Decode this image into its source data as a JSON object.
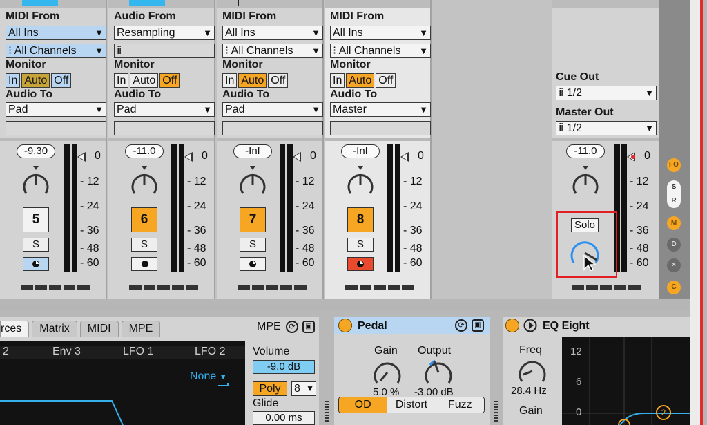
{
  "tracks": [
    {
      "midi_from_label": "MIDI From",
      "from": "All Ins",
      "channel": "All Channels",
      "monitor_label": "Monitor",
      "monitor": [
        "In",
        "Auto",
        "Off"
      ],
      "monitor_active": "Auto",
      "audio_to_label": "Audio To",
      "to": "Pad",
      "volume": "-9.30",
      "number": "5",
      "solo": "S"
    },
    {
      "midi_from_label": "Audio From",
      "from": "Resampling",
      "channel": "",
      "monitor_label": "Monitor",
      "monitor": [
        "In",
        "Auto",
        "Off"
      ],
      "monitor_active": "Off",
      "audio_to_label": "Audio To",
      "to": "Pad",
      "volume": "-11.0",
      "number": "6",
      "solo": "S"
    },
    {
      "midi_from_label": "MIDI From",
      "from": "All Ins",
      "channel": "All Channels",
      "monitor_label": "Monitor",
      "monitor": [
        "In",
        "Auto",
        "Off"
      ],
      "monitor_active": "Auto",
      "audio_to_label": "Audio To",
      "to": "Pad",
      "volume": "-Inf",
      "number": "7",
      "solo": "S"
    },
    {
      "midi_from_label": "MIDI From",
      "from": "All Ins",
      "channel": "All Channels",
      "monitor_label": "Monitor",
      "monitor": [
        "In",
        "Auto",
        "Off"
      ],
      "monitor_active": "Auto",
      "audio_to_label": "Audio To",
      "to": "Master",
      "volume": "-Inf",
      "number": "8",
      "solo": "S"
    }
  ],
  "meter_scale": [
    "0",
    "12",
    "24",
    "36",
    "48",
    "60"
  ],
  "master": {
    "cue_out_label": "Cue Out",
    "cue_out": "1/2",
    "master_out_label": "Master Out",
    "master_out": "1/2",
    "volume": "-11.0",
    "solo": "Solo"
  },
  "sidebar": {
    "io": "I·O",
    "s": "S",
    "r": "R",
    "m": "M",
    "d": "D",
    "x": "×",
    "c": "C"
  },
  "synth": {
    "tabs": [
      "rces",
      "Matrix",
      "MIDI",
      "MPE"
    ],
    "mpe": "MPE",
    "mod_heads": [
      "2",
      "Env 3",
      "LFO 1",
      "LFO 2"
    ],
    "none": "None",
    "volume_label": "Volume",
    "volume": "-9.0 dB",
    "poly": "Poly",
    "voices": "8",
    "glide_label": "Glide",
    "glide": "0.00 ms"
  },
  "pedal": {
    "title": "Pedal",
    "gain_label": "Gain",
    "gain": "5.0 %",
    "output_label": "Output",
    "output": "-3.00 dB",
    "modes": [
      "OD",
      "Distort",
      "Fuzz"
    ],
    "active_mode": "OD"
  },
  "eq": {
    "title": "EQ Eight",
    "freq_label": "Freq",
    "freq": "28.4 Hz",
    "gain_label": "Gain",
    "scale": [
      "12",
      "6",
      "0"
    ],
    "band": "2"
  },
  "colors": {
    "accent": "#f6a623",
    "select_blue": "#b8d6f2",
    "clip_blue": "#34b6ee",
    "highlight": "#e31e24"
  }
}
